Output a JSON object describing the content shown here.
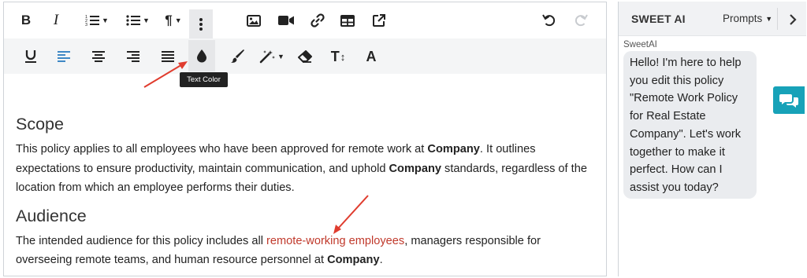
{
  "toolbar": {
    "row1": [
      "bold",
      "italic",
      "ordered-list",
      "unordered-list",
      "paragraph-format",
      "more",
      "insert-image",
      "insert-video",
      "insert-link",
      "insert-table",
      "external-link",
      "undo",
      "redo"
    ],
    "row2": [
      "underline",
      "align-left",
      "align-center",
      "align-right",
      "align-justify",
      "text-color",
      "brush",
      "magic-wand",
      "eraser",
      "text-size",
      "font"
    ],
    "bold_label": "B",
    "italic_label": "I",
    "paragraph_label": "¶",
    "font_label": "A",
    "text_size_label": "T",
    "text_color_tooltip": "Text Color",
    "active_color": "#3f88c5"
  },
  "document": {
    "sections": [
      {
        "heading": "Scope",
        "paragraph": {
          "t1": "This policy applies to all employees who have been approved for remote work at ",
          "b1": "Company",
          "t2": ". It outlines expectations to ensure productivity, maintain communication, and uphold ",
          "b2": "Company",
          "t3": " standards, regardless of the location from which an employee performs their duties."
        }
      },
      {
        "heading": "Audience",
        "paragraph": {
          "t1": "The intended audience for this policy includes all ",
          "red": "remote-working employees",
          "t2": ", managers responsible for overseeing remote teams, and human resource personnel at ",
          "b1": "Company",
          "t3": "."
        }
      }
    ],
    "highlight_color": "#c0392b"
  },
  "annotation_color": "#e03c2e",
  "panel": {
    "title": "SWEET AI",
    "prompts_label": "Prompts",
    "sender": "SweetAI",
    "message": "Hello! I'm here to help you edit this policy \"Remote Work Policy for Real Estate Company\". Let's work together to make it perfect. How can I assist you today?"
  },
  "chat_fab_color": "#17a2b8"
}
